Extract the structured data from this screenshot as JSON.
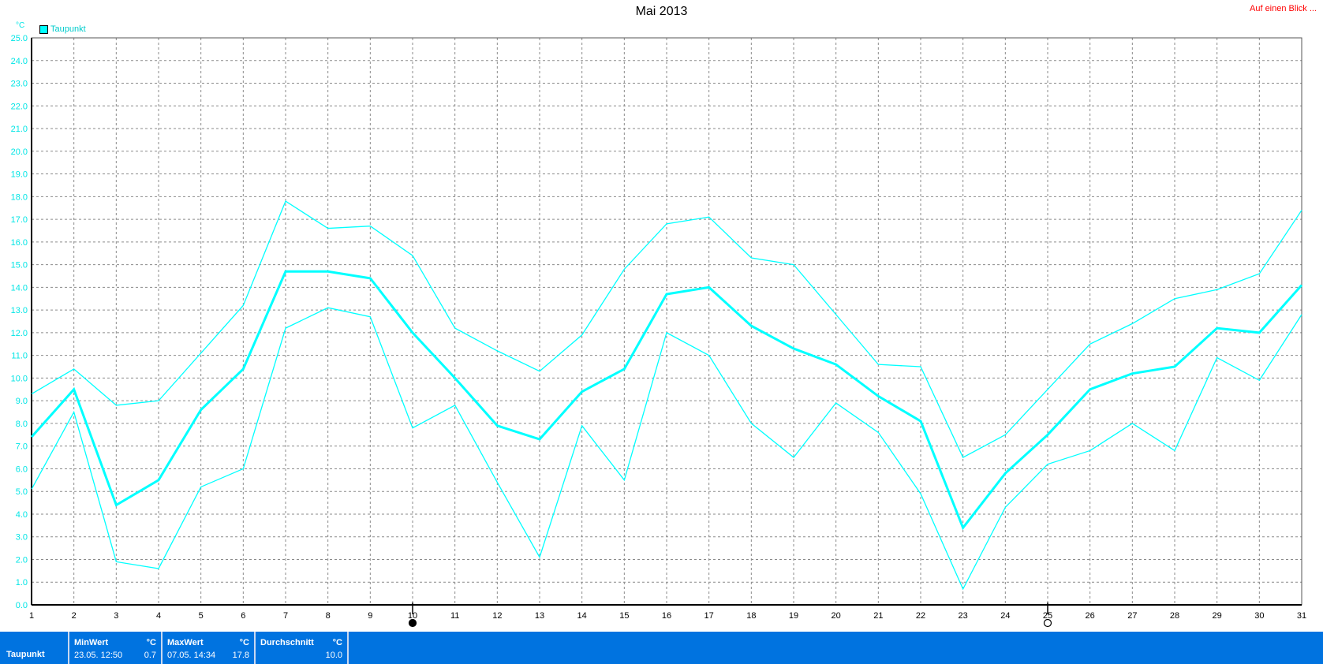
{
  "title": "Mai 2013",
  "top_link": "Auf einen Blick ...",
  "unit": "°C",
  "legend": {
    "label": "Taupunkt",
    "color": "#00ffff"
  },
  "colors": {
    "series": "#00ffff",
    "axis_text": "#00e5e5",
    "grid": "#8a8a8a",
    "stats_bg": "#0073e0",
    "link": "#ff0000"
  },
  "chart_data": {
    "type": "line",
    "title": "Mai 2013",
    "xlabel": "",
    "ylabel": "°C",
    "x": [
      1,
      2,
      3,
      4,
      5,
      6,
      7,
      8,
      9,
      10,
      11,
      12,
      13,
      14,
      15,
      16,
      17,
      18,
      19,
      20,
      21,
      22,
      23,
      24,
      25,
      26,
      27,
      28,
      29,
      30,
      31
    ],
    "xlim": [
      1,
      31
    ],
    "ylim": [
      0,
      25
    ],
    "y_ticks": [
      "0.0",
      "1.0",
      "2.0",
      "3.0",
      "4.0",
      "5.0",
      "6.0",
      "7.0",
      "8.0",
      "9.0",
      "10.0",
      "11.0",
      "12.0",
      "13.0",
      "14.0",
      "15.0",
      "16.0",
      "17.0",
      "18.0",
      "19.0",
      "20.0",
      "21.0",
      "22.0",
      "23.0",
      "24.0",
      "25.0"
    ],
    "grid": true,
    "legend_position": "top-left",
    "moon_phases": [
      {
        "day": 10,
        "phase": "new-moon"
      },
      {
        "day": 25,
        "phase": "full-moon"
      }
    ],
    "series": [
      {
        "name": "Taupunkt",
        "role": "max",
        "values": [
          9.3,
          10.4,
          8.8,
          9.0,
          11.1,
          13.2,
          17.8,
          16.6,
          16.7,
          15.4,
          12.2,
          11.2,
          10.3,
          11.9,
          14.8,
          16.8,
          17.1,
          15.3,
          15.0,
          12.8,
          10.6,
          10.5,
          6.5,
          7.5,
          9.5,
          11.5,
          12.4,
          13.5,
          13.9,
          14.6,
          17.4
        ]
      },
      {
        "name": "Taupunkt",
        "role": "average",
        "values": [
          7.4,
          9.5,
          4.4,
          5.5,
          8.6,
          10.4,
          14.7,
          14.7,
          14.4,
          12.0,
          10.0,
          7.9,
          7.3,
          9.4,
          10.4,
          13.7,
          14.0,
          12.3,
          11.3,
          10.6,
          9.2,
          8.1,
          3.4,
          5.8,
          7.5,
          9.5,
          10.2,
          10.5,
          12.2,
          12.0,
          14.1
        ]
      },
      {
        "name": "Taupunkt",
        "role": "min",
        "values": [
          5.1,
          8.5,
          1.9,
          1.6,
          5.2,
          6.0,
          12.2,
          13.1,
          12.7,
          7.8,
          8.8,
          5.4,
          2.1,
          7.9,
          5.5,
          12.0,
          11.0,
          8.0,
          6.5,
          8.9,
          7.6,
          4.9,
          0.7,
          4.3,
          6.2,
          6.8,
          8.0,
          6.8,
          10.9,
          9.9,
          12.8
        ]
      }
    ]
  },
  "stats": {
    "row_label": "Taupunkt",
    "min": {
      "header": "MinWert",
      "unit": "°C",
      "when": "23.05.  12:50",
      "value": "0.7"
    },
    "max": {
      "header": "MaxWert",
      "unit": "°C",
      "when": "07.05.  14:34",
      "value": "17.8"
    },
    "avg": {
      "header": "Durchschnitt",
      "unit": "°C",
      "value": "10.0"
    }
  }
}
